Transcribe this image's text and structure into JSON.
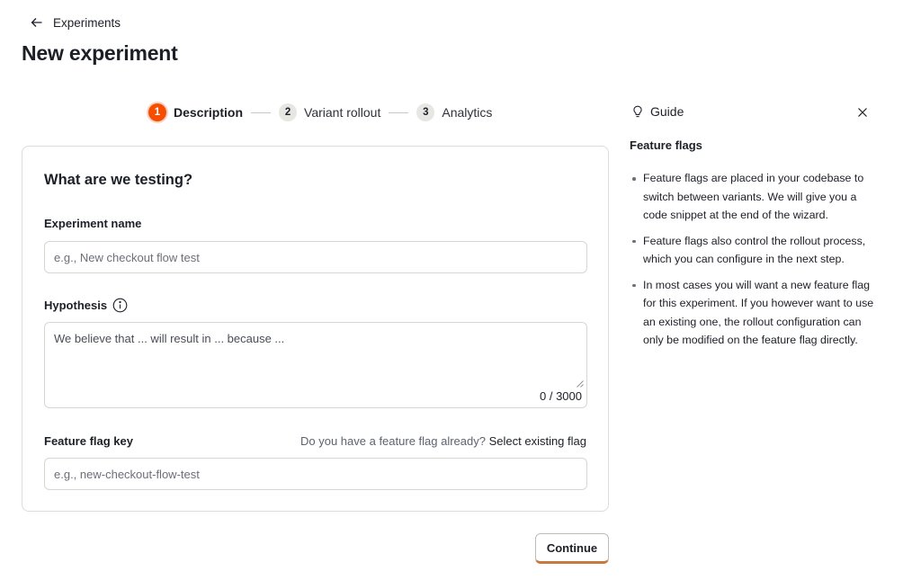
{
  "nav": {
    "back_label": "Experiments"
  },
  "page": {
    "title": "New experiment"
  },
  "stepper": {
    "steps": [
      {
        "number": "1",
        "label": "Description"
      },
      {
        "number": "2",
        "label": "Variant rollout"
      },
      {
        "number": "3",
        "label": "Analytics"
      }
    ],
    "active_step": 1
  },
  "form": {
    "title": "What are we testing?",
    "experiment_name": {
      "label": "Experiment name",
      "placeholder": "e.g., New checkout flow test",
      "value": ""
    },
    "hypothesis": {
      "label": "Hypothesis",
      "placeholder": "We believe that ... will result in ... because ...",
      "value": "",
      "char_count": "0 / 3000"
    },
    "feature_flag_key": {
      "label": "Feature flag key",
      "placeholder": "e.g., new-checkout-flow-test",
      "value": "",
      "hint_text": "Do you have a feature flag already?",
      "hint_link": "Select existing flag"
    },
    "continue_label": "Continue"
  },
  "guide": {
    "header": "Guide",
    "title": "Feature flags",
    "items": [
      "Feature flags are placed in your codebase to switch between variants. We will give you a code snippet at the end of the wizard.",
      "Feature flags also control the rollout process, which you can configure in the next step.",
      "In most cases you will want a new feature flag for this experiment. If you however want to use an existing one, the rollout configuration can only be modified on the feature flag directly."
    ]
  },
  "colors": {
    "accent": "#f54e00",
    "continue_border": "#c7793e"
  },
  "icons": {
    "back": "arrow-left-icon",
    "info": "info-icon",
    "guide": "lightbulb-icon",
    "close": "close-icon"
  }
}
